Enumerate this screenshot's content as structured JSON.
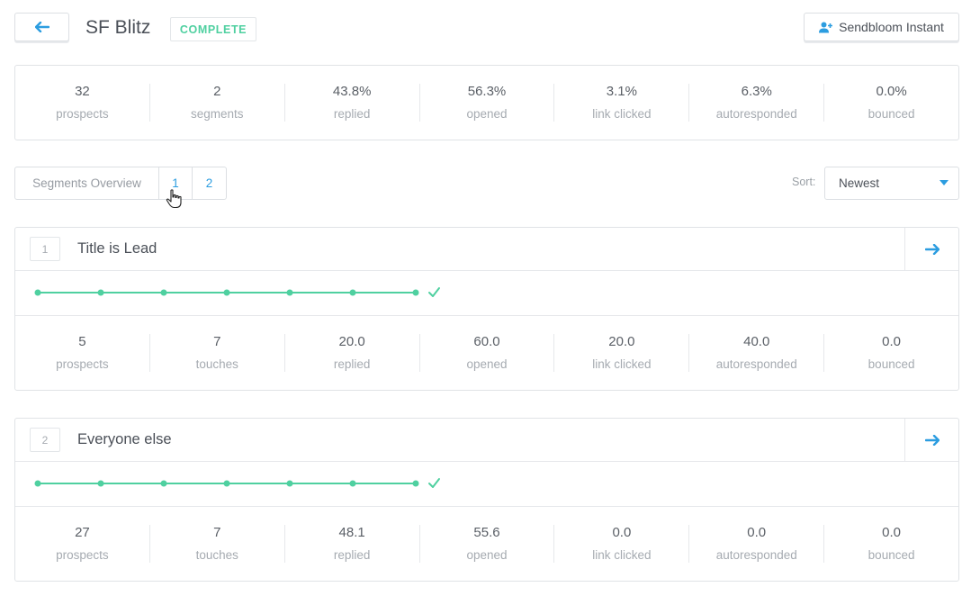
{
  "header": {
    "title": "SF Blitz",
    "status": "COMPLETE",
    "instant_button": "Sendbloom Instant"
  },
  "summary_stats": [
    {
      "value": "32",
      "label": "prospects"
    },
    {
      "value": "2",
      "label": "segments"
    },
    {
      "value": "43.8%",
      "label": "replied"
    },
    {
      "value": "56.3%",
      "label": "opened"
    },
    {
      "value": "3.1%",
      "label": "link clicked"
    },
    {
      "value": "6.3%",
      "label": "autoresponded"
    },
    {
      "value": "0.0%",
      "label": "bounced"
    }
  ],
  "tabs": {
    "overview": "Segments Overview",
    "tab1": "1",
    "tab2": "2"
  },
  "sort": {
    "label": "Sort:",
    "value": "Newest"
  },
  "segments": [
    {
      "number": "1",
      "title": "Title is Lead",
      "steps": 7,
      "complete": true,
      "stats": [
        {
          "value": "5",
          "label": "prospects"
        },
        {
          "value": "7",
          "label": "touches"
        },
        {
          "value": "20.0",
          "label": "replied"
        },
        {
          "value": "60.0",
          "label": "opened"
        },
        {
          "value": "20.0",
          "label": "link clicked"
        },
        {
          "value": "40.0",
          "label": "autoresponded"
        },
        {
          "value": "0.0",
          "label": "bounced"
        }
      ]
    },
    {
      "number": "2",
      "title": "Everyone else",
      "steps": 7,
      "complete": true,
      "stats": [
        {
          "value": "27",
          "label": "prospects"
        },
        {
          "value": "7",
          "label": "touches"
        },
        {
          "value": "48.1",
          "label": "replied"
        },
        {
          "value": "55.6",
          "label": "opened"
        },
        {
          "value": "0.0",
          "label": "link clicked"
        },
        {
          "value": "0.0",
          "label": "autoresponded"
        },
        {
          "value": "0.0",
          "label": "bounced"
        }
      ]
    }
  ],
  "colors": {
    "accent": "#2c9de0",
    "success": "#4fd0a0",
    "text": "#4b5058",
    "muted": "#a6abb1"
  },
  "icons": {
    "back": "arrow-left-icon",
    "instant": "user-plus-icon",
    "open_segment": "arrow-right-icon",
    "sort": "caret-down-icon",
    "complete": "check-icon",
    "cursor": "hand-pointer-icon"
  }
}
